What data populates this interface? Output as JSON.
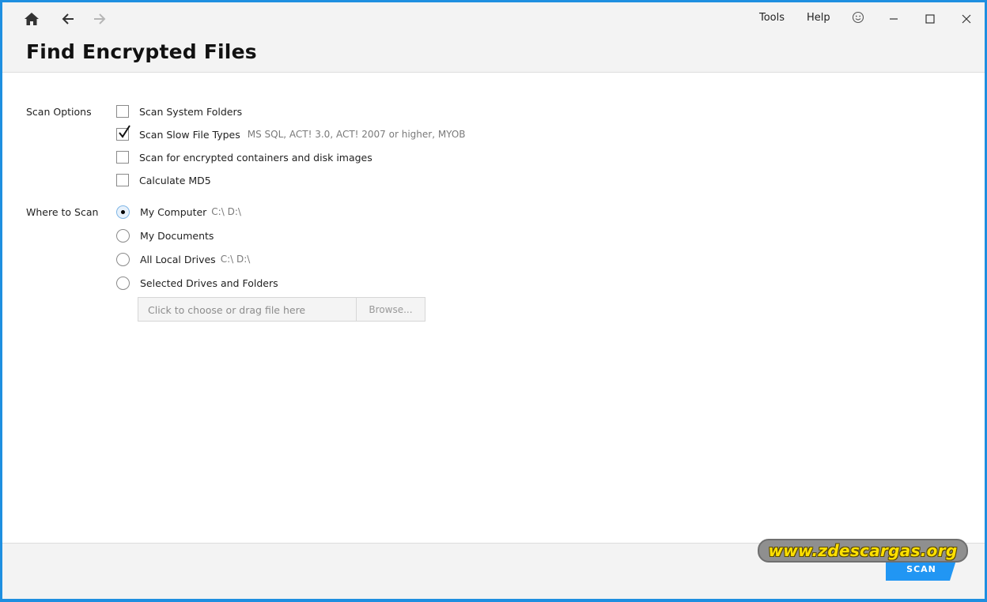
{
  "header": {
    "menu": {
      "tools": "Tools",
      "help": "Help"
    },
    "icons": {
      "home": "home-icon",
      "back": "arrow-left-icon",
      "forward": "arrow-right-icon",
      "feedback": "smiley-icon",
      "minimize": "minimize-icon",
      "maximize": "maximize-icon",
      "close": "close-icon"
    }
  },
  "page": {
    "title": "Find Encrypted Files"
  },
  "scan_options": {
    "label": "Scan Options",
    "items": [
      {
        "label": "Scan System Folders",
        "checked": false,
        "hint": ""
      },
      {
        "label": "Scan Slow File Types",
        "checked": true,
        "hint": "MS SQL, ACT! 3.0, ACT! 2007 or higher, MYOB"
      },
      {
        "label": "Scan for encrypted containers and disk images",
        "checked": false,
        "hint": ""
      },
      {
        "label": "Calculate MD5",
        "checked": false,
        "hint": ""
      }
    ]
  },
  "where_to_scan": {
    "label": "Where to Scan",
    "items": [
      {
        "label": "My Computer",
        "selected": true,
        "hint": "C:\\ D:\\"
      },
      {
        "label": "My Documents",
        "selected": false,
        "hint": ""
      },
      {
        "label": "All Local Drives",
        "selected": false,
        "hint": "C:\\ D:\\"
      },
      {
        "label": "Selected Drives and Folders",
        "selected": false,
        "hint": ""
      }
    ],
    "file_input_placeholder": "Click to choose or drag file here",
    "browse_label": "Browse..."
  },
  "footer": {
    "scan_label": "SCAN"
  },
  "watermark": {
    "text": "www.zdescargas.org"
  },
  "colors": {
    "accent": "#2196f3",
    "window_border": "#1e8fe0",
    "watermark_text": "#ffe000"
  }
}
